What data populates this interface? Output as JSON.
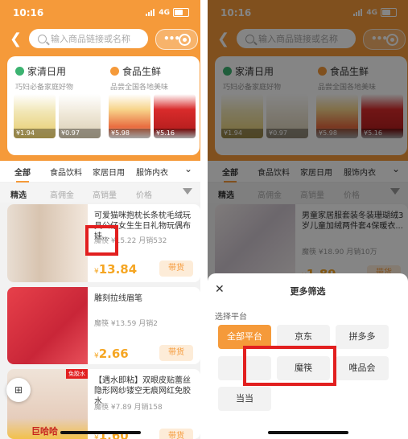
{
  "status": {
    "time": "10:16",
    "network": "4G"
  },
  "search": {
    "placeholder": "输入商品链接或名称"
  },
  "categories": [
    {
      "title": "家清日用",
      "subtitle": "巧妇必备家庭好物",
      "icon": "drop-icon",
      "color": "#3cb371",
      "prices": [
        "¥1.94",
        "¥0.97"
      ]
    },
    {
      "title": "食品生鲜",
      "subtitle": "品尝全国各地美味",
      "icon": "fire-icon",
      "color": "#f59a3a",
      "prices": [
        "¥5.98",
        "¥5.16"
      ]
    }
  ],
  "tabs": [
    "全部",
    "食品饮料",
    "家居日用",
    "服饰内衣"
  ],
  "sorts": [
    "精选",
    "高佣金",
    "高销量",
    "价格"
  ],
  "left_items": [
    {
      "title": "可爱猫咪抱枕长条枕毛绒玩具公仔女生生日礼物玩偶布娃...",
      "meta": "魔筷 ¥15.22  月销532",
      "price": "13.84",
      "cart": "带货"
    },
    {
      "title": "雕刻拉线眉笔",
      "meta": "魔筷 ¥13.59  月销2",
      "price": "2.66",
      "cart": "带货"
    },
    {
      "title": "【遇水即粘】双眼皮贴蕾丝隐形网纱镂空无痕网红免胶水",
      "meta": "魔筷 ¥7.89  月销158",
      "price": "1.60",
      "cart": "带货",
      "badge": "免胶水",
      "img_text": "巨哈哈"
    }
  ],
  "right_item": {
    "title": "男童家居服套装冬装珊瑚绒3岁儿童加绒两件套4保暖衣...",
    "meta": "魔筷 ¥18.90  月销10万",
    "price": "1.89",
    "cart": "带货"
  },
  "sheet": {
    "title": "更多筛选",
    "section": "选择平台",
    "options": [
      "全部平台",
      "京东",
      "拼多多",
      "",
      "魔筷",
      "唯品会",
      "当当"
    ]
  },
  "colors": {
    "accent": "#f59a3a",
    "price": "#f5a623",
    "highlight": "#e21f1f"
  }
}
